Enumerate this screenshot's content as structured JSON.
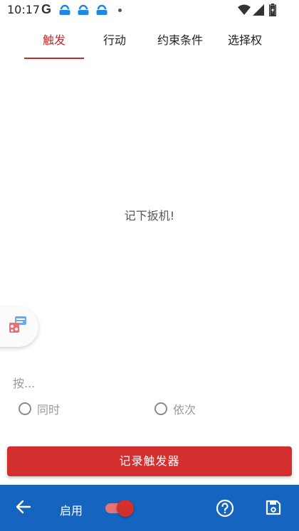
{
  "status_bar": {
    "time": "10:17",
    "google_letter": "G",
    "icons": [
      "google-icon",
      "app-notification-icon",
      "app-notification-icon",
      "app-notification-icon",
      "more-notifications-dot-icon",
      "wifi-icon",
      "cell-signal-icon",
      "battery-charging-icon"
    ]
  },
  "tabs": [
    {
      "label": "触发",
      "active": true
    },
    {
      "label": "行动",
      "active": false
    },
    {
      "label": "约束条件",
      "active": false
    },
    {
      "label": "选择权",
      "active": false
    }
  ],
  "main": {
    "empty_message": "记下扳机!",
    "press_label": "按...",
    "radio_options": [
      {
        "label": "同时",
        "selected": false
      },
      {
        "label": "依次",
        "selected": false
      }
    ],
    "record_button_label": "记录触发器"
  },
  "bottom_bar": {
    "enable_label": "启用",
    "enabled": true,
    "icons": [
      "back-arrow-icon",
      "help-icon",
      "save-icon"
    ]
  },
  "colors": {
    "accent_red": "#d32f2f",
    "tab_active": "#c62828",
    "bottom_bar_blue": "#1565c0",
    "notification_icon_blue": "#1e88e5"
  }
}
